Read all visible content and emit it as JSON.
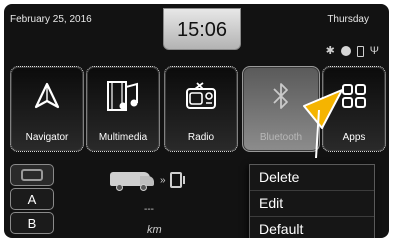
{
  "status_bar": {
    "date": "February 25, 2016",
    "time": "15:06",
    "day": "Thursday",
    "icons": [
      "bluetooth-icon",
      "record-dot-icon",
      "phone-icon",
      "antenna-icon"
    ]
  },
  "tiles": [
    {
      "label": "Navigator",
      "icon": "navigation-arrow-icon",
      "state": "normal"
    },
    {
      "label": "Multimedia",
      "icon": "multimedia-icon",
      "state": "normal"
    },
    {
      "label": "Radio",
      "icon": "radio-icon",
      "state": "normal"
    },
    {
      "label": "Bluetooth",
      "icon": "bluetooth-icon",
      "state": "pressed"
    },
    {
      "label": "Apps",
      "icon": "apps-grid-icon",
      "state": "normal"
    }
  ],
  "side_buttons": {
    "vehicle_icon": "bus-icon",
    "a_label": "A",
    "b_label": "B"
  },
  "trip": {
    "distance_value": "---",
    "unit": "km"
  },
  "context_menu": {
    "items": [
      {
        "label": "Delete"
      },
      {
        "label": "Edit"
      },
      {
        "label": "Default"
      }
    ]
  },
  "colors": {
    "background": "#121212",
    "clock_panel": "#d9d9d9",
    "pointer": "#f5b400",
    "pressed_tile": "#7a7a7a"
  }
}
